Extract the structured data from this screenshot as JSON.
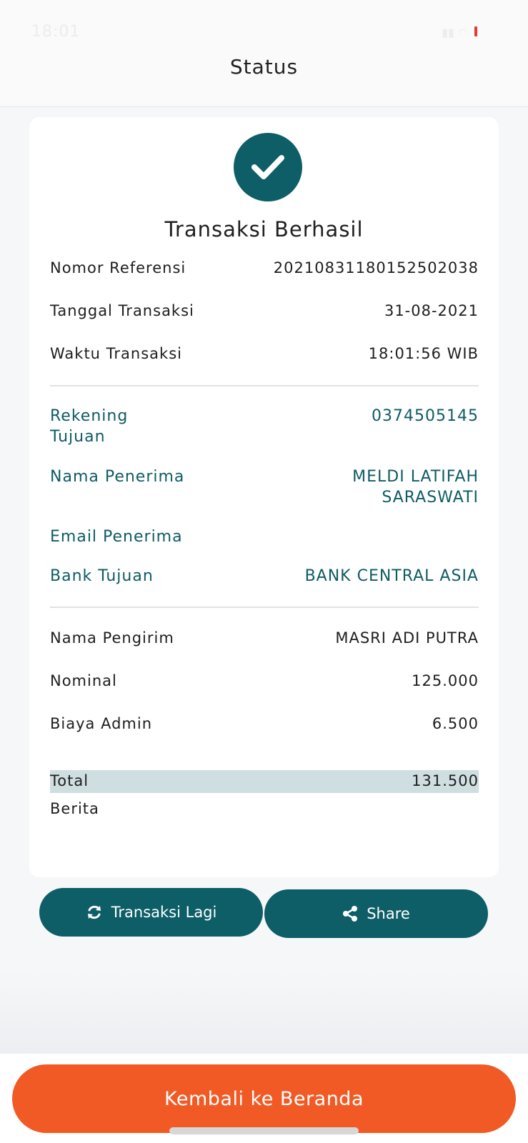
{
  "status_bar": {
    "time": "18:01",
    "battery_color": "#e53935"
  },
  "header": {
    "title": "Status"
  },
  "card": {
    "heading": "Transaksi Berhasil",
    "transaction": [
      {
        "label": "Nomor Referensi",
        "value": "20210831180152502038"
      },
      {
        "label": "Tanggal Transaksi",
        "value": "31-08-2021"
      },
      {
        "label": "Waktu Transaksi",
        "value": "18:01:56 WIB"
      }
    ],
    "recipient": {
      "account_label_1": "Rekening",
      "account_label_2": "Tujuan",
      "account_value": "0374505145",
      "name_label": "Nama Penerima",
      "name_value_1": "MELDI LATIFAH",
      "name_value_2": "SARASWATI",
      "email_label": "Email Penerima",
      "email_value": "",
      "bank_label": "Bank Tujuan",
      "bank_value": "BANK CENTRAL ASIA"
    },
    "payment": [
      {
        "label": "Nama Pengirim",
        "value": "MASRI ADI PUTRA"
      },
      {
        "label": "Nominal",
        "value": "125.000"
      },
      {
        "label": "Biaya Admin",
        "value": "6.500"
      },
      {
        "label": "Total",
        "value": "131.500"
      },
      {
        "label": "Berita",
        "value": ""
      }
    ]
  },
  "actions": {
    "repeat_label": "Transaksi Lagi",
    "share_label": "Share"
  },
  "footer": {
    "home_label": "Kembali ke Beranda"
  },
  "colors": {
    "primary": "#0d5e66",
    "accent": "#f25a25",
    "total_highlight": "#cfdee1"
  },
  "icons": {
    "success": "check-icon",
    "repeat": "refresh-icon",
    "share": "share-icon"
  }
}
